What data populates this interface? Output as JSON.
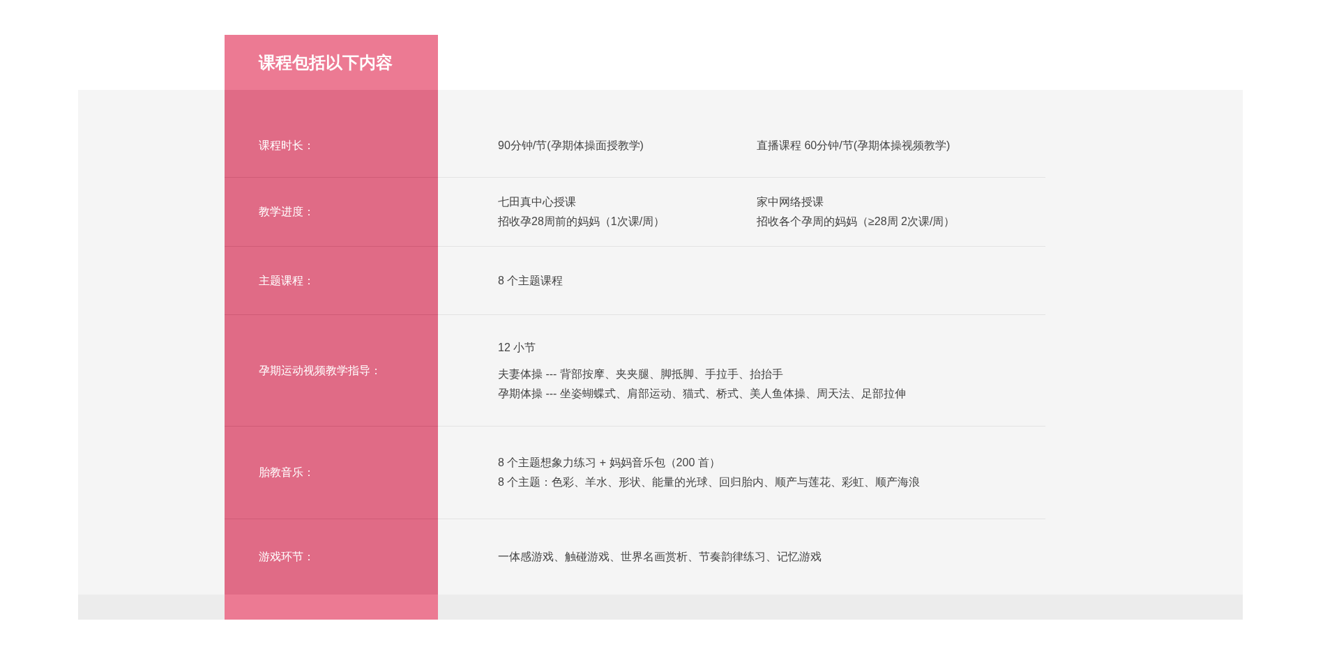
{
  "title": "课程包括以下内容",
  "rows": [
    {
      "label": "课程时长：",
      "columns": [
        {
          "paragraphs": [
            [
              "90分钟/节(孕期体操面授教学)"
            ]
          ]
        },
        {
          "paragraphs": [
            [
              "直播课程 60分钟/节(孕期体操视频教学)"
            ]
          ]
        }
      ]
    },
    {
      "label": "教学进度：",
      "columns": [
        {
          "paragraphs": [
            [
              "七田真中心授课",
              "招收孕28周前的妈妈（1次课/周）"
            ]
          ]
        },
        {
          "paragraphs": [
            [
              "家中网络授课",
              "招收各个孕周的妈妈（≥28周  2次课/周）"
            ]
          ]
        }
      ]
    },
    {
      "label": "主题课程：",
      "columns": [
        {
          "paragraphs": [
            [
              "8 个主题课程"
            ]
          ]
        }
      ]
    },
    {
      "label": "孕期运动视频教学指导：",
      "columns": [
        {
          "paragraphs": [
            [
              "12 小节"
            ],
            [
              "夫妻体操 --- 背部按摩、夹夹腿、脚抵脚、手拉手、抬抬手",
              "孕期体操 --- 坐姿蝴蝶式、肩部运动、猫式、桥式、美人鱼体操、周天法、足部拉伸"
            ]
          ]
        }
      ]
    },
    {
      "label": "胎教音乐：",
      "columns": [
        {
          "paragraphs": [
            [
              "8 个主题想象力练习 + 妈妈音乐包（200 首）",
              "8 个主题：色彩、羊水、形状、能量的光球、回归胎内、顺产与莲花、彩虹、顺产海浪"
            ]
          ]
        }
      ]
    },
    {
      "label": "游戏环节：",
      "columns": [
        {
          "paragraphs": [
            [
              "一体感游戏、触碰游戏、世界名画赏析、节奏韵律练习、记忆游戏"
            ]
          ]
        }
      ]
    }
  ]
}
